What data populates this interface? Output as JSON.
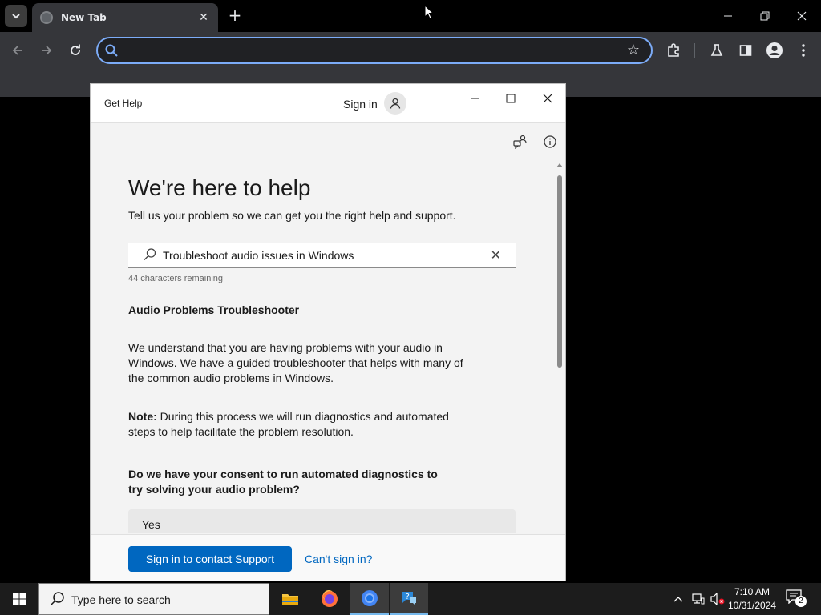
{
  "browser": {
    "tab_title": "New Tab",
    "omnibox_value": "",
    "omnibox_placeholder": ""
  },
  "get_help": {
    "app_title": "Get Help",
    "sign_in": "Sign in",
    "heading": "We're here to help",
    "subheading": "Tell us your problem so we can get you the right help and support.",
    "search_query": "Troubleshoot audio issues in Windows",
    "chars_remaining": "44 characters remaining",
    "troubleshooter_title": "Audio Problems Troubleshooter",
    "paragraph_1": "We understand that you are having problems with your audio in Windows. We have a guided troubleshooter that helps with many of the common audio problems in Windows.",
    "note_label": "Note:",
    "note_text": " During this process we will run diagnostics and automated steps to help facilitate the problem resolution.",
    "consent_question": "Do we have your consent to run automated diagnostics to try solving your audio problem?",
    "yes_option": "Yes",
    "contact_button": "Sign in to contact Support",
    "cant_sign_in": "Can't sign in?"
  },
  "taskbar": {
    "search_placeholder": "Type here to search",
    "time": "7:10 AM",
    "date": "10/31/2024",
    "notification_count": "2"
  },
  "colors": {
    "accent_blue": "#0067c0",
    "omnibox_focus": "#7cacf8",
    "chrome_toolbar": "#35363a"
  }
}
